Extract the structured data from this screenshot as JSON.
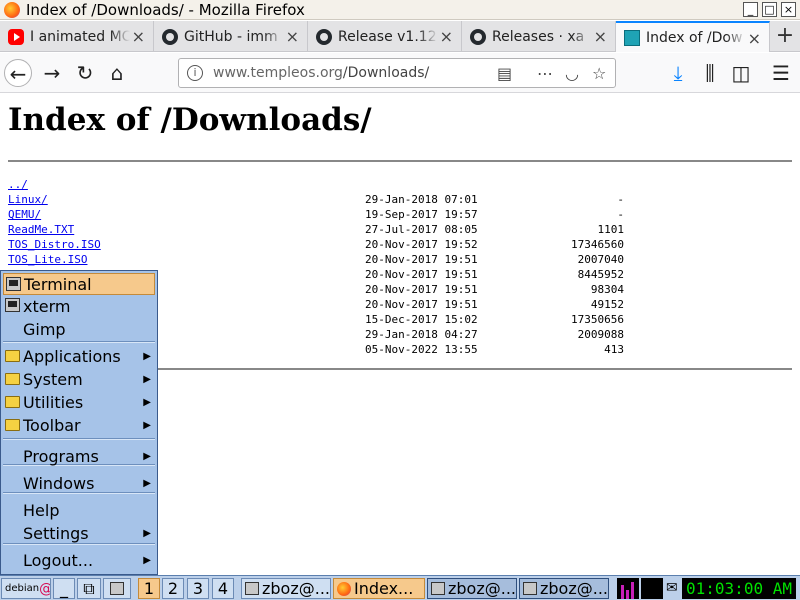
{
  "window": {
    "title": "Index of /Downloads/ - Mozilla Firefox",
    "controls": [
      "_",
      "□",
      "×"
    ]
  },
  "tabs": [
    {
      "label": "I animated MC",
      "icon": "youtube-icon",
      "active": false
    },
    {
      "label": "GitHub - imm",
      "icon": "github-icon",
      "active": false
    },
    {
      "label": "Release v1.12",
      "icon": "github-icon",
      "active": false
    },
    {
      "label": "Releases · xa",
      "icon": "github-icon",
      "active": false
    },
    {
      "label": "Index of /Dow",
      "icon": "templeos-icon",
      "active": true
    }
  ],
  "new_tab_label": "+",
  "nav": {
    "url_host": "www.templeos.org",
    "url_path": "/Downloads/"
  },
  "page": {
    "heading": "Index of /Downloads/",
    "entries": [
      {
        "name": "../",
        "date": "",
        "size": ""
      },
      {
        "name": "Linux/",
        "date": "29-Jan-2018 07:01",
        "size": "-"
      },
      {
        "name": "QEMU/",
        "date": "19-Sep-2017 19:57",
        "size": "-"
      },
      {
        "name": "ReadMe.TXT",
        "date": "27-Jul-2017 08:05",
        "size": "1101"
      },
      {
        "name": "TOS_Distro.ISO",
        "date": "20-Nov-2017 19:52",
        "size": "17346560"
      },
      {
        "name": "TOS_Lite.ISO",
        "date": "20-Nov-2017 19:51",
        "size": "2007040"
      },
      {
        "name": "",
        "date": "20-Nov-2017 19:51",
        "size": "8445952"
      },
      {
        "name": "",
        "date": "20-Nov-2017 19:51",
        "size": "98304"
      },
      {
        "name": "",
        "date": "20-Nov-2017 19:51",
        "size": "49152"
      },
      {
        "name": "",
        "date": "15-Dec-2017 15:02",
        "size": "17350656"
      },
      {
        "name": "",
        "date": "29-Jan-2018 04:27",
        "size": "2009088"
      },
      {
        "name": "",
        "date": "05-Nov-2022 13:55",
        "size": "413"
      }
    ]
  },
  "menu": {
    "items": [
      {
        "label": "Terminal",
        "icon": "terminal-icon",
        "submenu": false,
        "highlighted": true
      },
      {
        "label": "xterm",
        "icon": "terminal-icon",
        "submenu": false,
        "highlighted": false
      },
      {
        "label": "Gimp",
        "icon": "",
        "submenu": false,
        "highlighted": false
      },
      {
        "label": "Applications",
        "icon": "folder-icon",
        "submenu": true,
        "highlighted": false
      },
      {
        "label": "System",
        "icon": "folder-icon",
        "submenu": true,
        "highlighted": false
      },
      {
        "label": "Utilities",
        "icon": "folder-icon",
        "submenu": true,
        "highlighted": false
      },
      {
        "label": "Toolbar",
        "icon": "folder-icon",
        "submenu": true,
        "highlighted": false
      },
      {
        "label": "Programs",
        "icon": "",
        "submenu": true,
        "highlighted": false
      },
      {
        "label": "Windows",
        "icon": "",
        "submenu": true,
        "highlighted": false
      },
      {
        "label": "Help",
        "icon": "",
        "submenu": false,
        "highlighted": false
      },
      {
        "label": "Settings",
        "icon": "",
        "submenu": true,
        "highlighted": false
      },
      {
        "label": "Logout...",
        "icon": "",
        "submenu": true,
        "highlighted": false
      }
    ]
  },
  "taskbar": {
    "start_label": "debian",
    "show_desktop_label": "_",
    "workspaces": [
      "1",
      "2",
      "3",
      "4"
    ],
    "active_workspace": "1",
    "tasks": [
      {
        "label": "zboz@...",
        "icon": "terminal-icon",
        "active": false
      },
      {
        "label": "Index...",
        "icon": "firefox-icon",
        "active": true
      },
      {
        "label": "zboz@...",
        "icon": "terminal-icon",
        "active": false
      },
      {
        "label": "zboz@...",
        "icon": "terminal-icon",
        "active": false
      }
    ],
    "clock": "01:03:00 AM"
  },
  "colors": {
    "accent": "#0a84ff",
    "menu_bg": "#a6c3e8",
    "menu_highlight": "#f6c98c",
    "link": "#0000ee",
    "clock_fg": "#00e000"
  }
}
